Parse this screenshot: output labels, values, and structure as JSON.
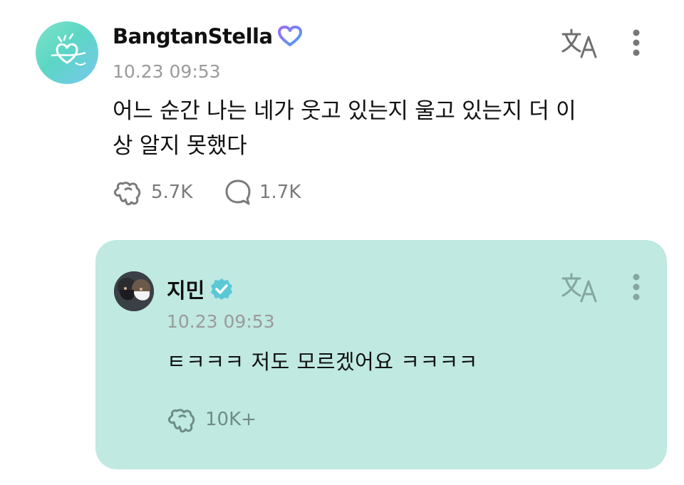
{
  "post": {
    "author": "BangtanStella",
    "timestamp": "10.23 09:53",
    "text_line1": "어느 순간 나는 네가 웃고 있는지 울고 있는지 더 이",
    "text_line2": "상 알지 못했다",
    "likes": "5.7K",
    "comments": "1.7K",
    "badge_icon": "heart-outline-icon",
    "accent_color": "#7b6ff0"
  },
  "reply": {
    "author": "지민",
    "timestamp": "10.23 09:53",
    "text": "ㅌㅋㅋㅋ 저도 모르겠어요 ㅋㅋㅋㅋ",
    "likes": "10K+",
    "badge_icon": "verified-check-icon",
    "card_color": "#bfe9e1",
    "badge_color": "#5bc8d6"
  }
}
